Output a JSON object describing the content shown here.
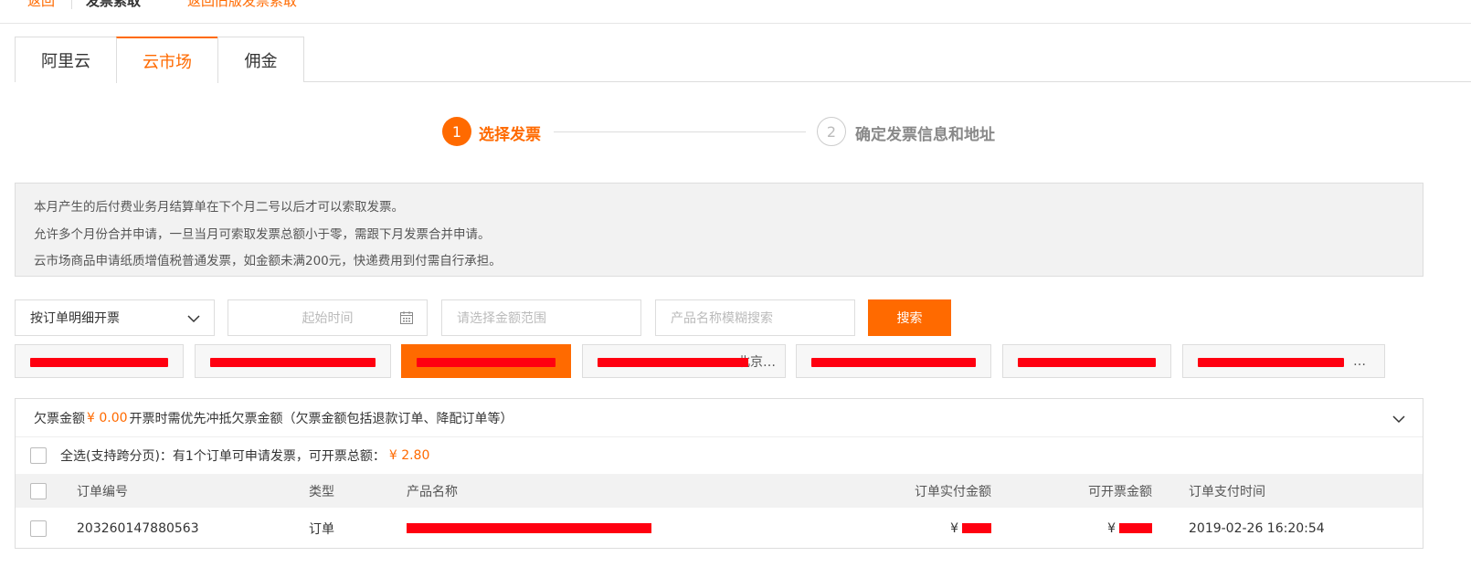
{
  "topbar": {
    "back_label": "返回",
    "current_label": "发票索取",
    "link_label": "返回旧版发票索取"
  },
  "tabs": [
    {
      "label": "阿里云",
      "active": false
    },
    {
      "label": "云市场",
      "active": true
    },
    {
      "label": "佣金",
      "active": false
    }
  ],
  "steps": [
    {
      "number": "1",
      "label": "选择发票",
      "active": true
    },
    {
      "number": "2",
      "label": "确定发票信息和地址",
      "active": false
    }
  ],
  "notice": [
    "本月产生的后付费业务月结算单在下个月二号以后才可以索取发票。",
    "允许多个月份合并申请，一旦当月可索取发票总额小于零，需跟下月发票合并申请。",
    "云市场商品申请纸质增值税普通发票，如金额未满200元，快递费用到付需自行承担。"
  ],
  "filters": {
    "invoice_mode": "按订单明细开票",
    "start_time_placeholder": "起始时间",
    "amount_placeholder": "请选择金额范围",
    "product_placeholder": "产品名称模糊搜索",
    "search_label": "搜索"
  },
  "companies": [
    {
      "name": "",
      "active": false
    },
    {
      "name": "",
      "active": false
    },
    {
      "name": "",
      "active": true
    },
    {
      "name": "北京…",
      "active": false
    },
    {
      "name": "",
      "active": false
    },
    {
      "name": "",
      "active": false
    },
    {
      "name": "…",
      "active": false
    }
  ],
  "owe": {
    "prefix": "欠票金额",
    "amount": "¥ 0.00",
    "suffix": "开票时需优先冲抵欠票金额（欠票金额包括退款订单、降配订单等）"
  },
  "select_all": {
    "text": "全选(支持跨分页)：有1个订单可申请发票，可开票总额：",
    "amount": "¥ 2.80"
  },
  "table": {
    "headers": {
      "order_no": "订单编号",
      "type": "类型",
      "product": "产品名称",
      "paid": "订单实付金额",
      "invoiceable": "可开票金额",
      "pay_time": "订单支付时间"
    },
    "rows": [
      {
        "order_no": "203260147880563",
        "type": "订单",
        "product": "",
        "paid_currency": "¥",
        "invoiceable_currency": "¥",
        "pay_time": "2019-02-26 16:20:54"
      }
    ]
  },
  "colors": {
    "accent": "#ff6a00",
    "redaction": "#ff0010"
  }
}
